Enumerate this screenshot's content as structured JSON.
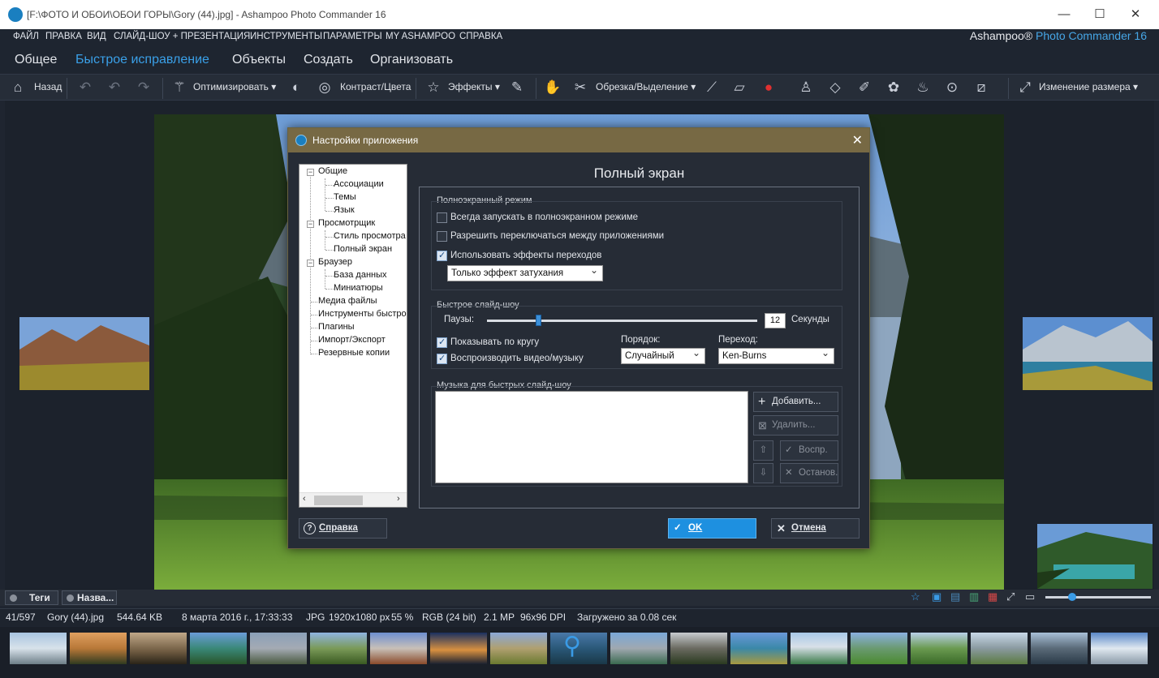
{
  "window": {
    "title": "[F:\\ФОТО И ОБОИ\\ОБОИ ГОРЫ\\Gory (44).jpg] - Ashampoo Photo Commander 16",
    "minimize": "—",
    "maximize": "☐",
    "close": "✕"
  },
  "menu": {
    "items": [
      "ФАЙЛ",
      "ПРАВКА",
      "ВИД",
      "СЛАЙД-ШОУ + ПРЕЗЕНТАЦИЯ",
      "ИНСТРУМЕНТЫ",
      "ПАРАМЕТРЫ",
      "MY ASHAMPOO",
      "СПРАВКА"
    ],
    "brand_a": "Ashampoo®",
    "brand_b": "Photo Commander 16"
  },
  "tabs": [
    "Общее",
    "Быстрое исправление",
    "Объекты",
    "Создать",
    "Организовать"
  ],
  "toolbar": {
    "back": "Назад",
    "optimize": "Оптимизировать",
    "contrast": "Контраст/Цвета",
    "effects": "Эффекты",
    "crop": "Обрезка/Выделение",
    "resize": "Изменение размера"
  },
  "dialog": {
    "title": "Настройки приложения",
    "close": "✕",
    "tree": [
      "Общие",
      "Ассоциации",
      "Темы",
      "Язык",
      "Просмотрщик",
      "Стиль просмотра",
      "Полный экран",
      "Браузер",
      "База данных",
      "Миниатюры",
      "Медиа файлы",
      "Инструменты быстро",
      "Плагины",
      "Импорт/Экспорт",
      "Резервные копии"
    ],
    "page_title": "Полный экран",
    "fullscreen_group": "Полноэкранный режим",
    "opt_always": "Всегда запускать в полноэкранном режиме",
    "opt_switch": "Разрешить переключаться между приложениями",
    "opt_effects": "Использовать эффекты переходов",
    "effects_combo": "Только эффект затухания",
    "slideshow_group": "Быстрое слайд-шоу",
    "pauses_label": "Паузы:",
    "pauses_value": "12",
    "pauses_fraction": 0.19,
    "seconds": "Секунды",
    "opt_loop": "Показывать по кругу",
    "opt_video": "Воспроизводить видео/музыку",
    "order_label": "Порядок:",
    "order_value": "Случайный",
    "transition_label": "Переход:",
    "transition_value": "Ken-Burns",
    "music_group": "Музыка для быстрых слайд-шоу",
    "add": "Добавить...",
    "remove": "Удалить...",
    "play": "Воспр.",
    "stop": "Останов.",
    "help": "Справка",
    "ok": "OK",
    "cancel": "Отмена"
  },
  "panel_tabs": {
    "tags": "Теги",
    "names": "Назва..."
  },
  "status": {
    "index": "41/597",
    "file": "Gory (44).jpg",
    "size": "544.64 KB",
    "date": "8 марта 2016 г., 17:33:33",
    "format": "JPG",
    "dims": "1920x1080 px",
    "zoom": "55 %",
    "color": "RGB (24 bit)",
    "mp": "2.1 MP",
    "dpi": "96x96 DPI",
    "loaded": "Загружено за 0.08 сек"
  },
  "colors": {
    "accent": "#3aa0e8",
    "dialog_title": "#776944",
    "ok_button": "#1e90e0"
  }
}
